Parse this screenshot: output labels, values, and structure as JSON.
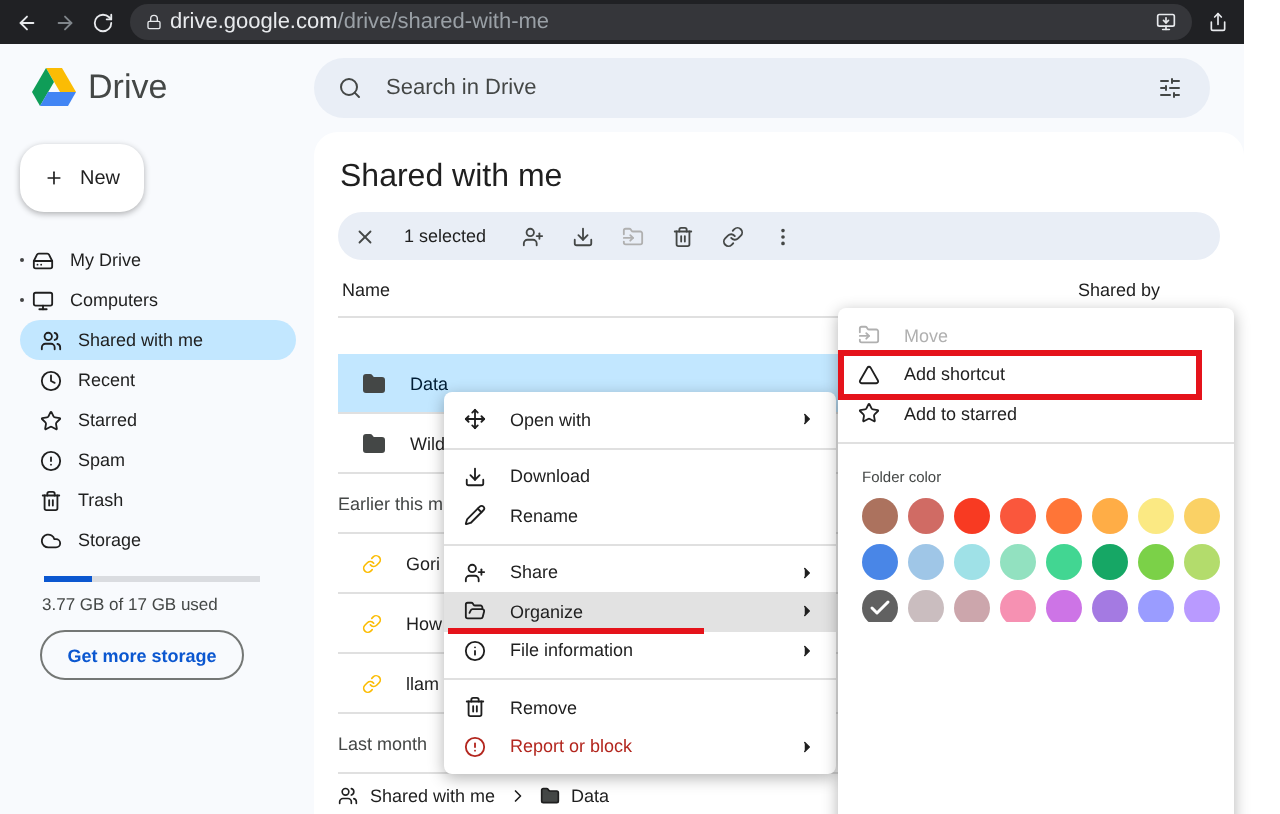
{
  "browser": {
    "url_host": "drive.google.com",
    "url_path": "/drive/shared-with-me"
  },
  "app": {
    "name": "Drive"
  },
  "search": {
    "placeholder": "Search in Drive"
  },
  "new_button": "New",
  "sidebar": {
    "items": [
      {
        "label": "My Drive",
        "expandable": true,
        "selected": false
      },
      {
        "label": "Computers",
        "expandable": true,
        "selected": false
      },
      {
        "label": "Shared with me",
        "expandable": false,
        "selected": true
      },
      {
        "label": "Recent",
        "expandable": false,
        "selected": false
      },
      {
        "label": "Starred",
        "expandable": false,
        "selected": false
      },
      {
        "label": "Spam",
        "expandable": false,
        "selected": false
      },
      {
        "label": "Trash",
        "expandable": false,
        "selected": false
      },
      {
        "label": "Storage",
        "expandable": false,
        "selected": false
      }
    ]
  },
  "storage": {
    "level": 0.22,
    "text": "3.77 GB of 17 GB used",
    "button": "Get more storage"
  },
  "page_title": "Shared with me",
  "selection_bar": {
    "count": "1 selected"
  },
  "table": {
    "columns": [
      "Name",
      "Shared by"
    ],
    "items": [
      {
        "kind": "folder",
        "name": "Data",
        "selected": true
      },
      {
        "kind": "folder",
        "name": "Wild",
        "selected": false
      },
      {
        "kind": "heading",
        "name": "Earlier this m"
      },
      {
        "kind": "shortcut",
        "name": "Gori",
        "selected": false
      },
      {
        "kind": "shortcut",
        "name": "How",
        "selected": false
      },
      {
        "kind": "shortcut",
        "name": "llam",
        "selected": false
      },
      {
        "kind": "heading",
        "name": "Last month"
      }
    ]
  },
  "breadcrumb": [
    "Shared with me",
    "Data"
  ],
  "context_menu": {
    "groups": [
      [
        {
          "label": "Open with",
          "kind": "normal",
          "submenu": true,
          "highlighted": false,
          "underlined": false
        }
      ],
      [
        {
          "label": "Download",
          "kind": "normal",
          "submenu": false,
          "highlighted": false,
          "underlined": false
        },
        {
          "label": "Rename",
          "kind": "normal",
          "submenu": false,
          "highlighted": false,
          "underlined": false
        }
      ],
      [
        {
          "label": "Share",
          "kind": "normal",
          "submenu": true,
          "highlighted": false,
          "underlined": false
        },
        {
          "label": "Organize",
          "kind": "normal",
          "submenu": true,
          "highlighted": true,
          "underlined": true
        },
        {
          "label": "File information",
          "kind": "normal",
          "submenu": true,
          "highlighted": false,
          "underlined": false
        }
      ],
      [
        {
          "label": "Remove",
          "kind": "normal",
          "submenu": false,
          "highlighted": false,
          "underlined": false
        },
        {
          "label": "Report or block",
          "kind": "danger",
          "submenu": true,
          "highlighted": false,
          "underlined": false
        }
      ]
    ]
  },
  "submenu": {
    "items": [
      {
        "label": "Move",
        "disabled": true,
        "annotated": false
      },
      {
        "label": "Add shortcut",
        "disabled": false,
        "annotated": true
      },
      {
        "label": "Add to starred",
        "disabled": false,
        "annotated": false
      }
    ],
    "folder_color_label": "Folder color",
    "swatches": [
      {
        "color": "#ac725e",
        "selected": false
      },
      {
        "color": "#d06b64",
        "selected": false
      },
      {
        "color": "#f83a22",
        "selected": false
      },
      {
        "color": "#fa573c",
        "selected": false
      },
      {
        "color": "#ff7537",
        "selected": false
      },
      {
        "color": "#ffad46",
        "selected": false
      },
      {
        "color": "#fbe983",
        "selected": false
      },
      {
        "color": "#fad165",
        "selected": false
      },
      {
        "color": "#4986e7",
        "selected": false
      },
      {
        "color": "#9fc6e7",
        "selected": false
      },
      {
        "color": "#9fe1e7",
        "selected": false
      },
      {
        "color": "#92e1c0",
        "selected": false
      },
      {
        "color": "#42d692",
        "selected": false
      },
      {
        "color": "#16a765",
        "selected": false
      },
      {
        "color": "#7bd148",
        "selected": false
      },
      {
        "color": "#b3dc6c",
        "selected": false
      },
      {
        "color": "#616161",
        "selected": true
      },
      {
        "color": "#cabdbf",
        "selected": false
      },
      {
        "color": "#cca6ac",
        "selected": false
      },
      {
        "color": "#f691b2",
        "selected": false
      },
      {
        "color": "#cd74e6",
        "selected": false
      },
      {
        "color": "#a47ae2",
        "selected": false
      },
      {
        "color": "#9a9cff",
        "selected": false
      },
      {
        "color": "#b99aff",
        "selected": false
      }
    ]
  }
}
